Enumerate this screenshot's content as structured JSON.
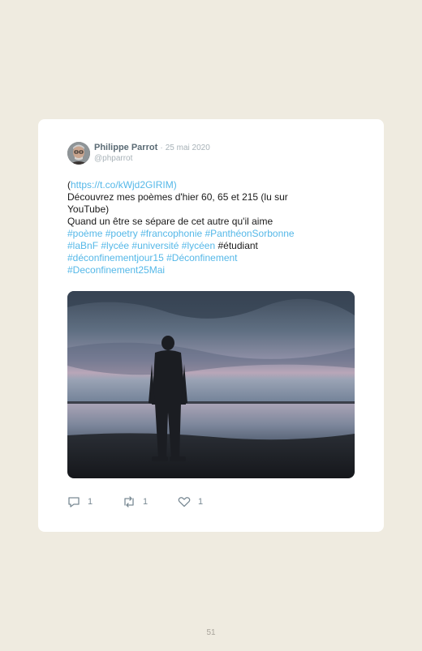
{
  "tweet": {
    "author_name": "Philippe Parrot",
    "separator": "·",
    "date": "25 mai 2020",
    "handle": "@phparrot",
    "link_open": "(",
    "link": "https://t.co/kWjd2GIRIM",
    "link_close": ")",
    "line2": "Découvrez mes poèmes d'hier 60, 65 et 215 (lu sur YouTube)",
    "line3": "Quand un être se sépare de cet autre qu'il aime",
    "hashtags": [
      "#poème",
      "#poetry",
      "#francophonie",
      "#PanthéonSorbonne",
      "#laBnF",
      "#lycée",
      "#université",
      "#lycéen"
    ],
    "plain_word": "#étudiant",
    "hashtags_end": [
      "#déconfinementjour15",
      "#Déconfinement",
      "#Deconfinement25Mai"
    ],
    "image_icon": "person-silhouette-at-lake-dusk",
    "reply_count": "1",
    "retweet_count": "1",
    "like_count": "1"
  },
  "page_number": "51",
  "colors": {
    "background": "#efebe0",
    "card": "#ffffff",
    "link": "#55b8e8",
    "name": "#5b6b75",
    "muted": "#a8b2b8"
  },
  "icons": [
    "reply-icon",
    "retweet-icon",
    "like-icon"
  ]
}
